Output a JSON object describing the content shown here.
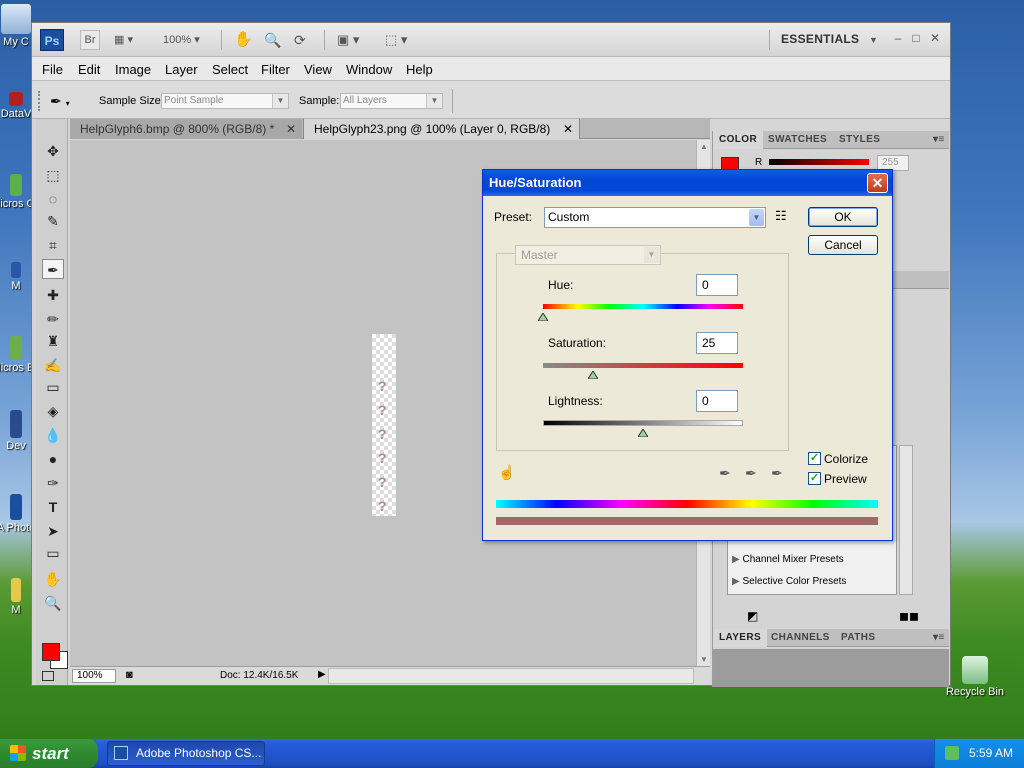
{
  "desktop": {
    "icons": [
      {
        "label": "My C"
      },
      {
        "label": "DataV"
      },
      {
        "label": "Micros C+"
      },
      {
        "label": "M"
      },
      {
        "label": "Micros Ba"
      },
      {
        "label": "Dev"
      },
      {
        "label": "A Photo"
      },
      {
        "label": "M"
      }
    ],
    "recycle_bin": "Recycle Bin"
  },
  "app": {
    "logo": "Ps",
    "br": "Br",
    "zoom": "100%",
    "workspace": "ESSENTIALS",
    "menus": [
      "File",
      "Edit",
      "Image",
      "Layer",
      "Select",
      "Filter",
      "View",
      "Window",
      "Help"
    ],
    "options": {
      "sample_size_label": "Sample Size:",
      "sample_size_value": "Point Sample",
      "sample_label": "Sample:",
      "sample_value": "All Layers"
    },
    "tabs": [
      {
        "label": "HelpGlyph6.bmp @ 800% (RGB/8) *"
      },
      {
        "label": "HelpGlyph23.png @ 100% (Layer 0, RGB/8)"
      }
    ],
    "status": {
      "zoom": "100%",
      "doc": "Doc: 12.4K/16.5K"
    },
    "panels": {
      "color_tabs": [
        "COLOR",
        "SWATCHES",
        "STYLES"
      ],
      "r_label": "R",
      "r_value": "255",
      "adjustments": [
        "Channel Mixer Presets",
        "Selective Color Presets"
      ],
      "layer_tabs": [
        "LAYERS",
        "CHANNELS",
        "PATHS"
      ]
    },
    "colors": {
      "foreground": "#ff0000",
      "background": "#ffffff"
    }
  },
  "dialog": {
    "title": "Hue/Saturation",
    "preset_label": "Preset:",
    "preset_value": "Custom",
    "channel": "Master",
    "hue_label": "Hue:",
    "hue_value": "0",
    "saturation_label": "Saturation:",
    "saturation_value": "25",
    "lightness_label": "Lightness:",
    "lightness_value": "0",
    "ok": "OK",
    "cancel": "Cancel",
    "colorize_label": "Colorize",
    "preview_label": "Preview",
    "colorize_checked": true,
    "preview_checked": true,
    "colorize_tint": "#9e6b67"
  },
  "taskbar": {
    "start": "start",
    "item": "Adobe Photoshop CS...",
    "clock": "5:59 AM"
  }
}
